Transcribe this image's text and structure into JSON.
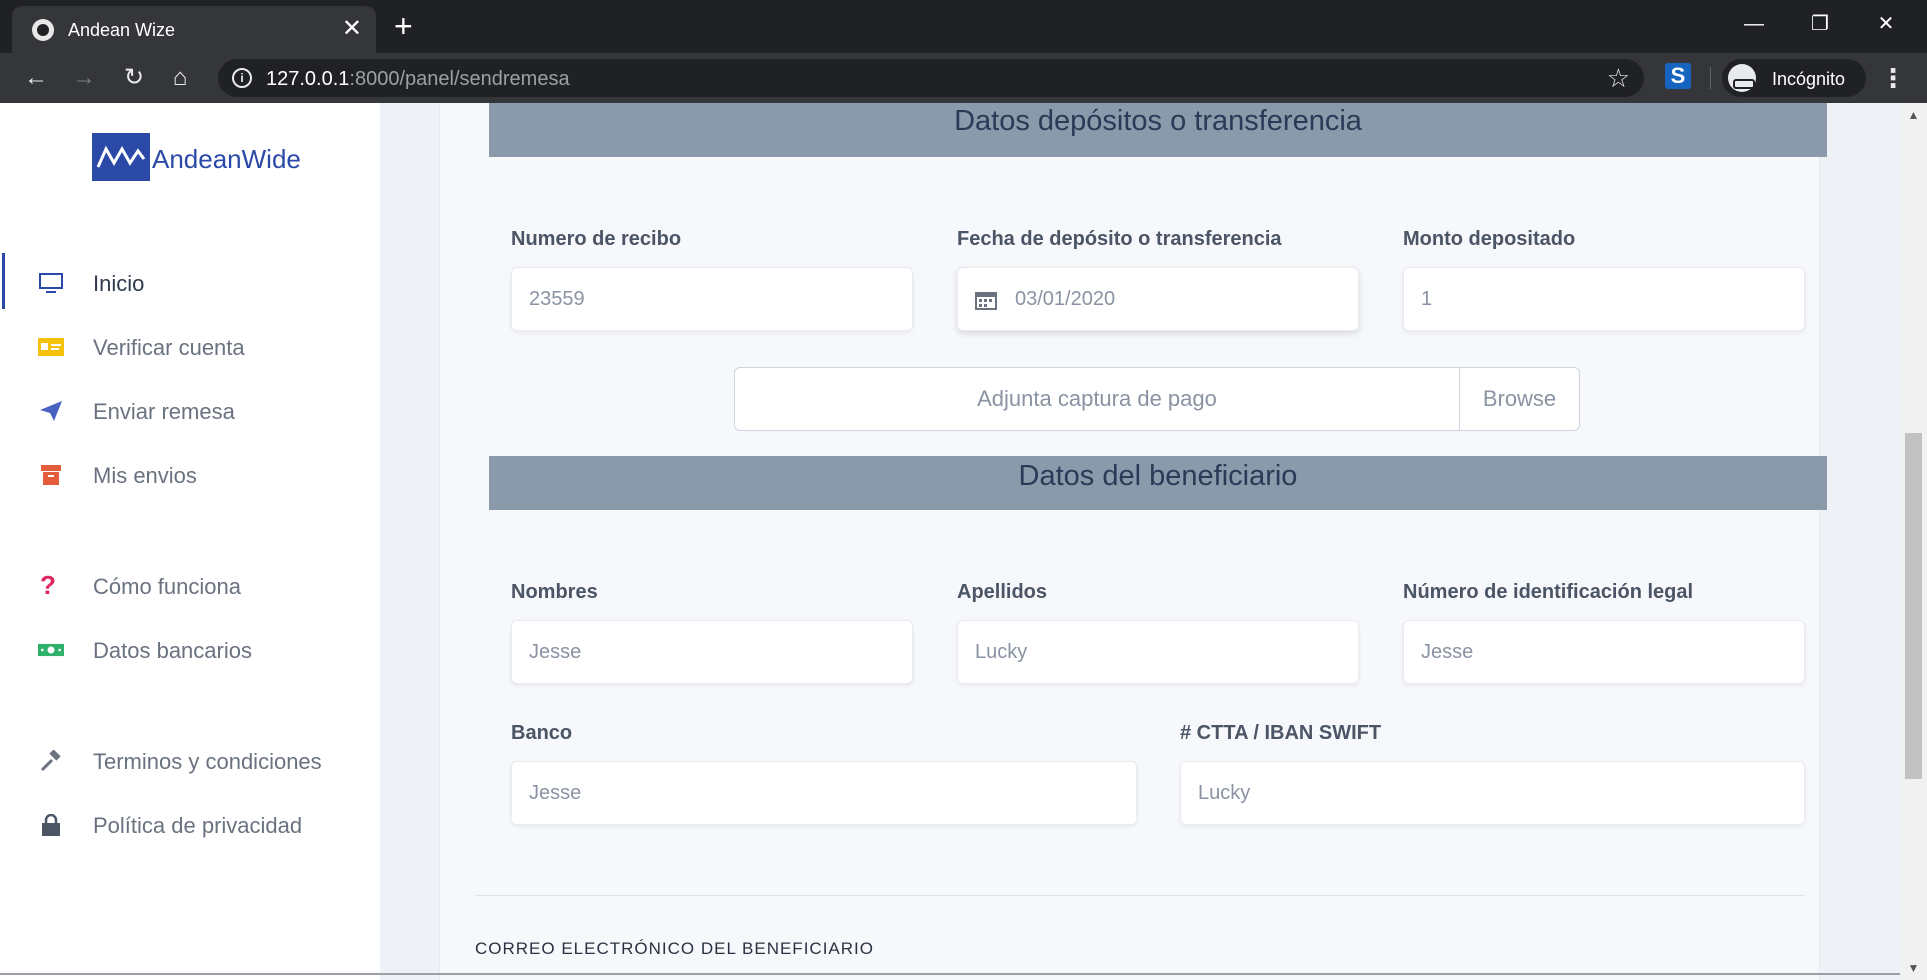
{
  "browser": {
    "tab_title": "Andean Wize",
    "close_glyph": "✕",
    "new_tab_glyph": "+",
    "url_host": "127.0.0.1",
    "url_rest": ":8000/panel/sendremesa",
    "incognito_label": "Incógnito"
  },
  "sidebar": {
    "logo_text": "AndeanWide",
    "items": [
      {
        "label": "Inicio",
        "icon": "monitor-icon",
        "color": "#2b4aa8"
      },
      {
        "label": "Verificar cuenta",
        "icon": "id-card-icon",
        "color": "#f4c20d"
      },
      {
        "label": "Enviar remesa",
        "icon": "paper-plane-icon",
        "color": "#4a62c2"
      },
      {
        "label": "Mis envios",
        "icon": "archive-icon",
        "color": "#e35d3d"
      },
      {
        "label": "Cómo funciona",
        "icon": "question-icon",
        "color": "#e0245e"
      },
      {
        "label": "Datos bancarios",
        "icon": "money-icon",
        "color": "#2fb06b"
      },
      {
        "label": "Terminos y condiciones",
        "icon": "gavel-icon",
        "color": "#6b7280"
      },
      {
        "label": "Política de privacidad",
        "icon": "lock-icon",
        "color": "#4b5563"
      }
    ]
  },
  "deposit": {
    "header": "Datos depósitos o transferencia",
    "receipt_label": "Numero de recibo",
    "receipt_value": "23559",
    "date_label": "Fecha de depósito o transferencia",
    "date_value": "03/01/2020",
    "amount_label": "Monto depositado",
    "amount_value": "1",
    "attach_placeholder": "Adjunta captura de pago",
    "browse_label": "Browse"
  },
  "beneficiary": {
    "header": "Datos del beneficiario",
    "first_name_label": "Nombres",
    "first_name_value": "Jesse",
    "last_name_label": "Apellidos",
    "last_name_value": "Lucky",
    "id_label": "Número de identificación legal",
    "id_value": "Jesse",
    "bank_label": "Banco",
    "bank_value": "Jesse",
    "account_label": "# CTTA / IBAN SWIFT",
    "account_value": "Lucky",
    "email_section_label": "CORREO ELECTRÓNICO DEL BENEFICIARIO"
  }
}
